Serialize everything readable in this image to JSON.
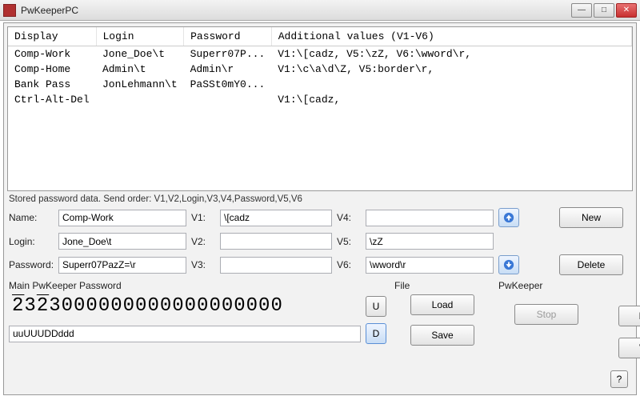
{
  "window": {
    "title": "PwKeeperPC"
  },
  "table": {
    "headers": {
      "display": "Display",
      "login": "Login",
      "password": "Password",
      "additional": "Additional values (V1-V6)"
    },
    "rows": [
      {
        "display": "Comp-Work",
        "login": "Jone_Doe\\t",
        "password": "Superr07P...",
        "additional": "V1:\\[cadz, V5:\\zZ, V6:\\wword\\r,"
      },
      {
        "display": "Comp-Home",
        "login": "Admin\\t",
        "password": "Admin\\r",
        "additional": "V1:\\c\\a\\d\\Z, V5:border\\r,"
      },
      {
        "display": "Bank Pass",
        "login": "JonLehmann\\t",
        "password": "PaSSt0mY0...",
        "additional": ""
      },
      {
        "display": "Ctrl-Alt-Del",
        "login": "",
        "password": "",
        "additional": "V1:\\[cadz,"
      }
    ]
  },
  "hint": "Stored password data. Send order: V1,V2,Login,V3,V4,Password,V5,V6",
  "form": {
    "labels": {
      "name": "Name:",
      "login": "Login:",
      "password": "Password:",
      "v1": "V1:",
      "v2": "V2:",
      "v3": "V3:",
      "v4": "V4:",
      "v5": "V5:",
      "v6": "V6:"
    },
    "values": {
      "name": "Comp-Work",
      "login": "Jone_Doe\\t",
      "password": "Superr07PazZ=\\r",
      "v1": "\\[cadz",
      "v2": "",
      "v3": "",
      "v4": "",
      "v5": "\\zZ",
      "v6": "\\wword\\r"
    }
  },
  "buttons": {
    "new": "New",
    "delete": "Delete",
    "load": "Load",
    "save": "Save",
    "read": "Read",
    "stop": "Stop",
    "write": "Write",
    "u": "U",
    "d": "D",
    "help": "?"
  },
  "sections": {
    "main_pw": "Main PwKeeper Password",
    "file": "File",
    "pwkeeper": "PwKeeper"
  },
  "main_pw": {
    "digits_html": "<span class='ul'>2</span>3<span class='ul'>2</span>3000000000000000000",
    "typed": "uuUUUDDddd"
  }
}
